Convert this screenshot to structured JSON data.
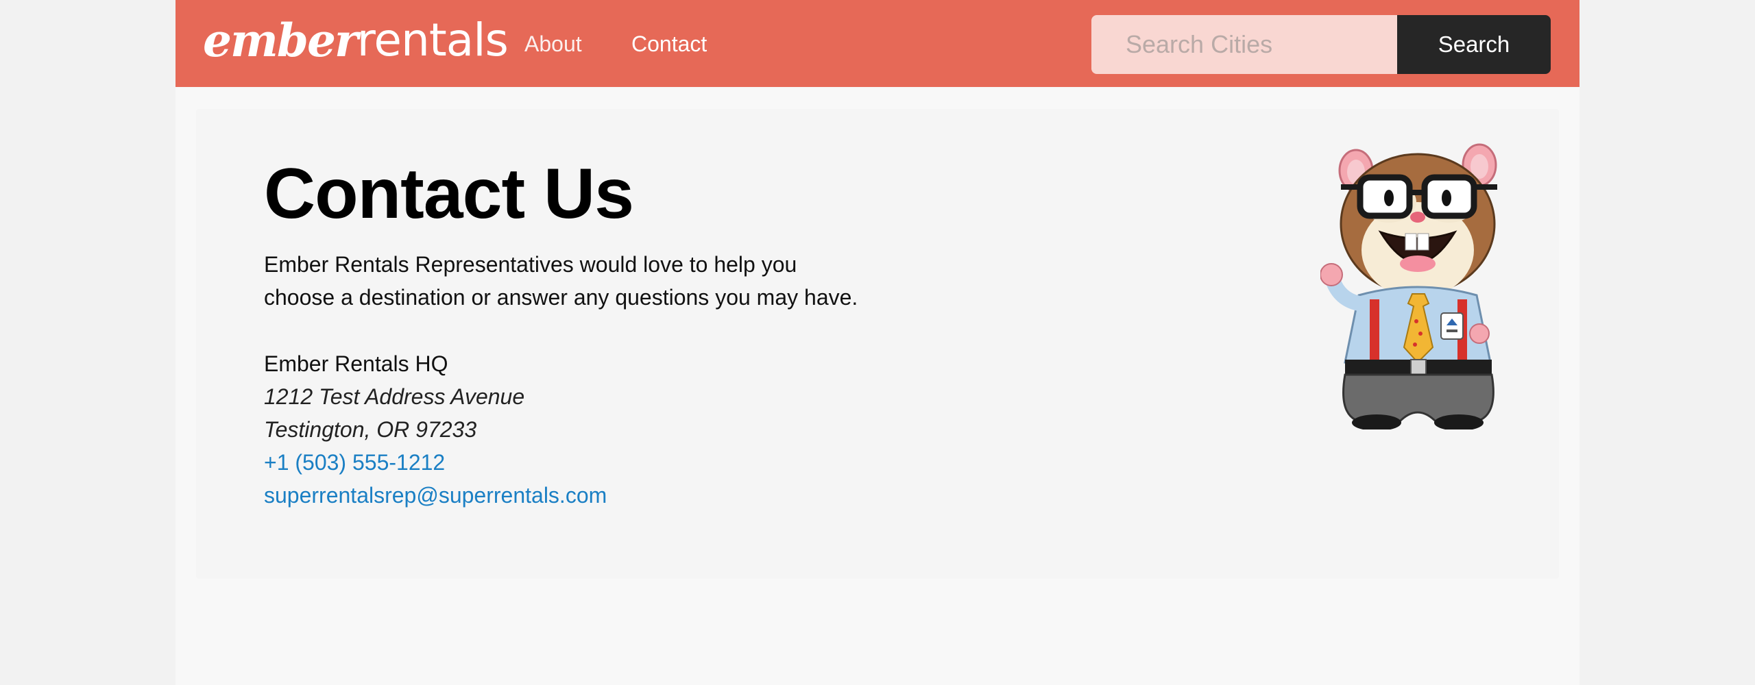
{
  "navbar": {
    "logo_part1": "ember",
    "logo_part2": "rentals",
    "links": [
      {
        "label": "About"
      },
      {
        "label": "Contact"
      }
    ],
    "search": {
      "placeholder": "Search Cities",
      "button_label": "Search"
    }
  },
  "contact": {
    "title": "Contact Us",
    "intro_line1": "Ember Rentals Representatives would love to help you",
    "intro_line2": "choose a destination or answer any questions you may have.",
    "hq_name": "Ember Rentals HQ",
    "street": "1212 Test Address Avenue",
    "city": "Testington, OR 97233",
    "phone": "+1 (503) 555-1212",
    "email": "superrentalsrep@superrentals.com"
  },
  "mascot": {
    "icon": "hamster-mascot-icon"
  },
  "colors": {
    "navbar": "#e66957",
    "search_field": "#f9d7d2",
    "search_button": "#262626",
    "link": "#1a7fc4"
  }
}
